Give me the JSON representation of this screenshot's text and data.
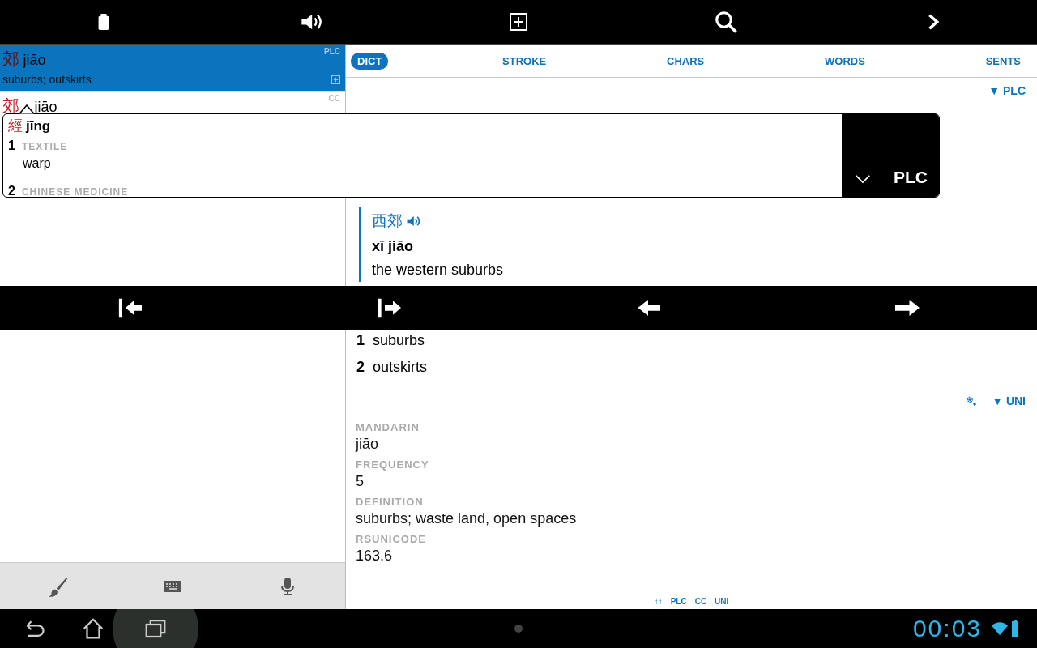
{
  "results": [
    {
      "hanzi": "郊",
      "pinyin": "jiāo",
      "gloss": "suburbs; outskirts",
      "source": "PLC",
      "selected": true
    },
    {
      "hanzi": "郊",
      "pinyin": "jiāo",
      "source": "CC",
      "selected": false
    }
  ],
  "tabs": [
    {
      "label": "DICT",
      "selected": true
    },
    {
      "label": "STROKE",
      "selected": false
    },
    {
      "label": "CHARS",
      "selected": false
    },
    {
      "label": "WORDS",
      "selected": false
    },
    {
      "label": "SENTS",
      "selected": false
    }
  ],
  "dict_section": {
    "source": "▼ PLC",
    "example": {
      "hanzi": "西郊",
      "pinyin": "xī jiāo",
      "gloss": "the western suburbs"
    },
    "senses": [
      {
        "number": "1",
        "text": "suburbs"
      },
      {
        "number": "2",
        "text": "outskirts"
      }
    ]
  },
  "unihan_section": {
    "source": "▼ UNI",
    "fields": [
      {
        "label": "MANDARIN",
        "value": "jiāo"
      },
      {
        "label": "FREQUENCY",
        "value": "5"
      },
      {
        "label": "DEFINITION",
        "value": "suburbs; waste land, open spaces"
      },
      {
        "label": "RSUNICODE",
        "value": "163.6"
      }
    ]
  },
  "footer_links": [
    "↑↑",
    "PLC",
    "CC",
    "UNI"
  ],
  "popup": {
    "hanzi": "經",
    "pinyin": "jīng",
    "source": "PLC",
    "senses": [
      {
        "number": "1",
        "domain": "TEXTILE",
        "gloss": "warp"
      },
      {
        "number": "2",
        "domain": "CHINESE MEDICINE"
      }
    ]
  },
  "status_bar": {
    "clock": "00:03"
  }
}
